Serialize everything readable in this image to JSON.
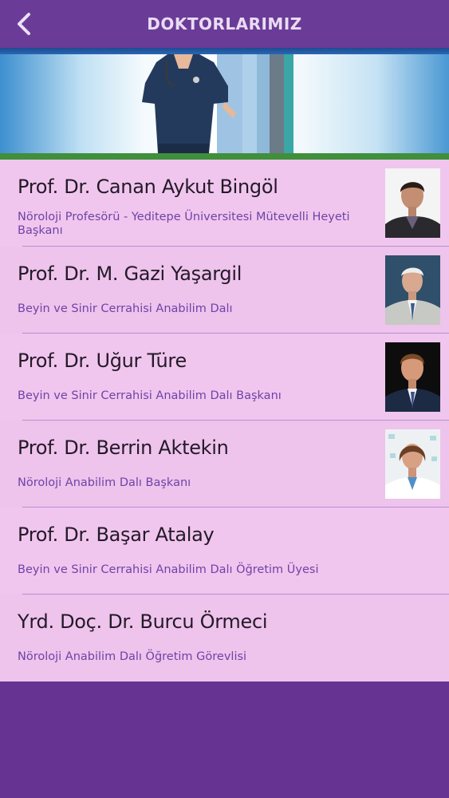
{
  "header": {
    "title": "DOKTORLARIMIZ",
    "back_icon": "chevron-left-icon"
  },
  "colors": {
    "header_bg": "#6a3c97",
    "list_bg": "#f0c6ee",
    "name_color": "#231a28",
    "subtitle_color": "#6f43a6",
    "page_bg": "#673393"
  },
  "doctors": [
    {
      "name": "Prof. Dr. Canan Aykut Bingöl",
      "title": "Nöroloji Profesörü - Yeditepe Üniversitesi Mütevelli Heyeti Başkanı",
      "has_photo": true
    },
    {
      "name": "Prof. Dr. M. Gazi Yaşargil",
      "title": "Beyin ve Sinir Cerrahisi Anabilim Dalı",
      "has_photo": true
    },
    {
      "name": "Prof. Dr. Uğur Türe",
      "title": "Beyin ve Sinir Cerrahisi Anabilim Dalı Başkanı",
      "has_photo": true
    },
    {
      "name": "Prof. Dr. Berrin Aktekin",
      "title": "Nöroloji Anabilim Dalı Başkanı",
      "has_photo": true
    },
    {
      "name": "Prof. Dr. Başar Atalay",
      "title": "Beyin ve Sinir Cerrahisi Anabilim Dalı Öğretim Üyesi",
      "has_photo": false
    },
    {
      "name": "Yrd. Doç. Dr. Burcu Örmeci",
      "title": "Nöroloji Anabilim Dalı Öğretim Görevlisi",
      "has_photo": false
    }
  ]
}
